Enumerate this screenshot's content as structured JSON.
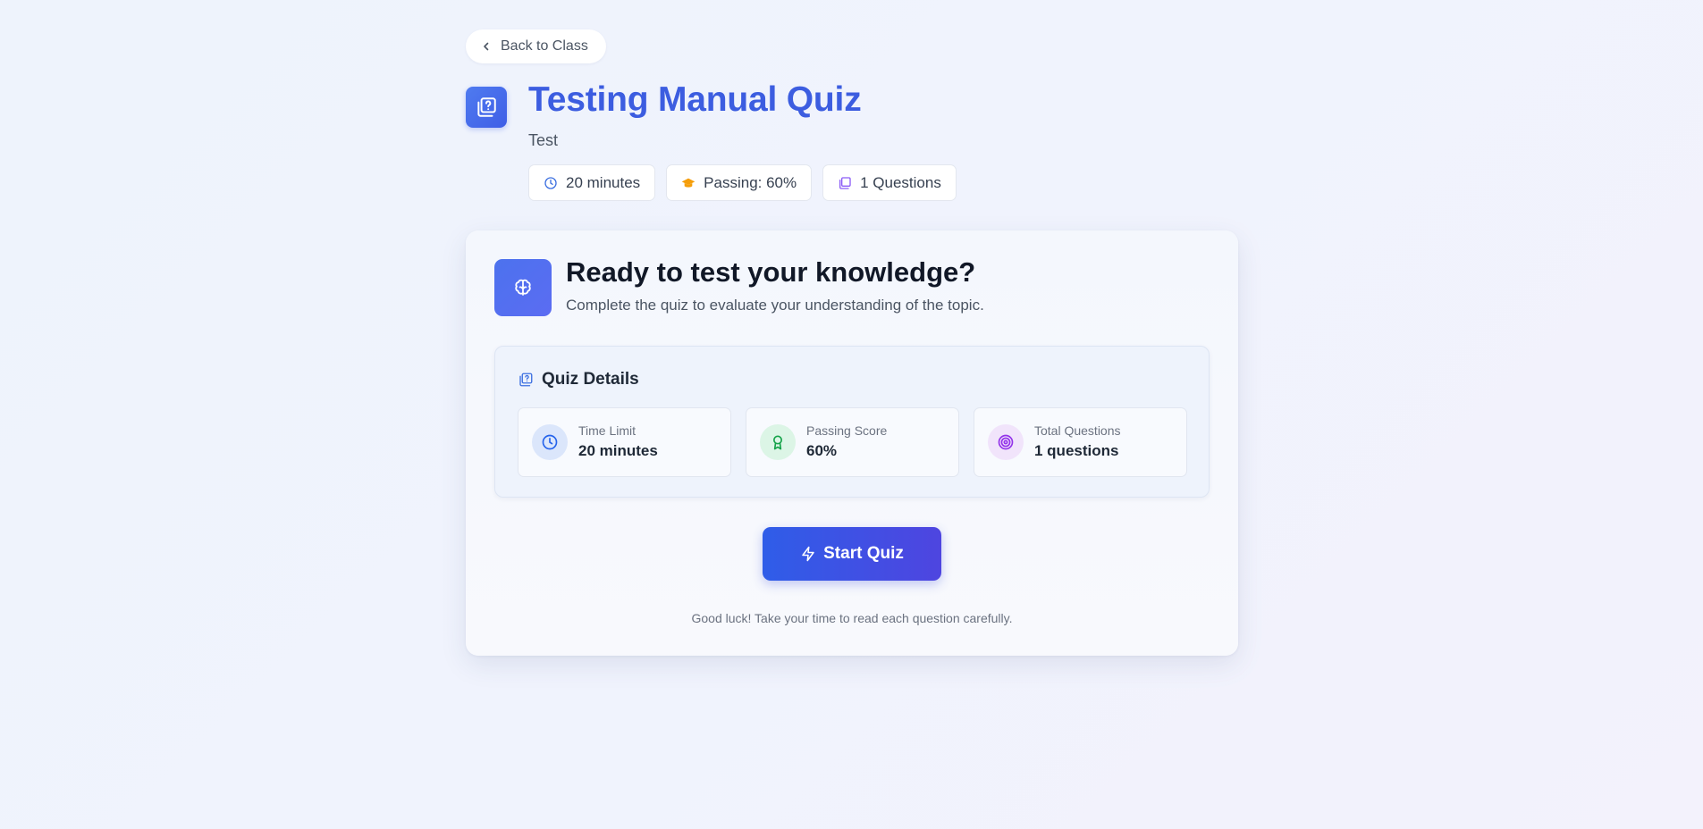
{
  "nav": {
    "back_label": "Back to Class"
  },
  "header": {
    "title": "Testing Manual Quiz",
    "subtitle": "Test",
    "chips": [
      {
        "label": "20 minutes",
        "icon": "clock-icon",
        "color": "#3b6fe0"
      },
      {
        "label": "Passing: 60%",
        "icon": "graduation-cap-icon",
        "color": "#f59e0b"
      },
      {
        "label": "1 Questions",
        "icon": "question-book-icon",
        "color": "#8b5cf6"
      }
    ]
  },
  "card": {
    "heading": "Ready to test your knowledge?",
    "subheading": "Complete the quiz to evaluate your understanding of the topic.",
    "icon": "brain-icon",
    "details": {
      "title": "Quiz Details",
      "stats": [
        {
          "label": "Time Limit",
          "value": "20 minutes",
          "icon": "clock-icon",
          "color": "#2563eb",
          "bg": "#dbe6fb"
        },
        {
          "label": "Passing Score",
          "value": "60%",
          "icon": "award-icon",
          "color": "#16a34a",
          "bg": "#dcf5e6"
        },
        {
          "label": "Total Questions",
          "value": "1 questions",
          "icon": "target-icon",
          "color": "#9333ea",
          "bg": "#f1e4fb"
        }
      ]
    },
    "start_label": "Start Quiz",
    "footnote": "Good luck! Take your time to read each question carefully."
  },
  "colors": {
    "accent": "#3c5de0",
    "button_start": "#2f5de8",
    "button_end": "#4e45e0"
  }
}
